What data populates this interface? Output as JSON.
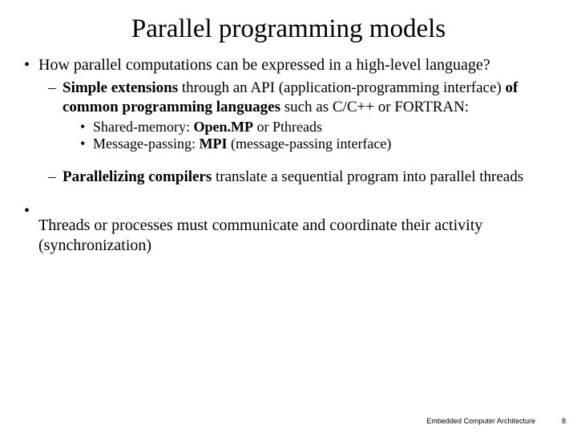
{
  "title": "Parallel programming models",
  "bullets": {
    "b1": "How parallel computations can be expressed in a high-level language?",
    "b2a": "Simple extensions",
    "b2b": " through an API (application-programming interface) ",
    "b2c": "of common programming languages",
    "b2d": " such as C/C++ or FORTRAN:",
    "b3a_pre": "Shared-memory: ",
    "b3a_bold": "Open.MP",
    "b3a_post": " or Pthreads",
    "b3b_pre": "Message-passing: ",
    "b3b_bold": "MPI",
    "b3b_post": " (message-passing interface)",
    "b4a": "Parallelizing compilers",
    "b4b": " translate a sequential program into parallel threads",
    "b5": "Threads or processes must communicate and coordinate their activity (synchronization)"
  },
  "footer": {
    "label": "Embedded Computer Architecture",
    "page": "8"
  }
}
